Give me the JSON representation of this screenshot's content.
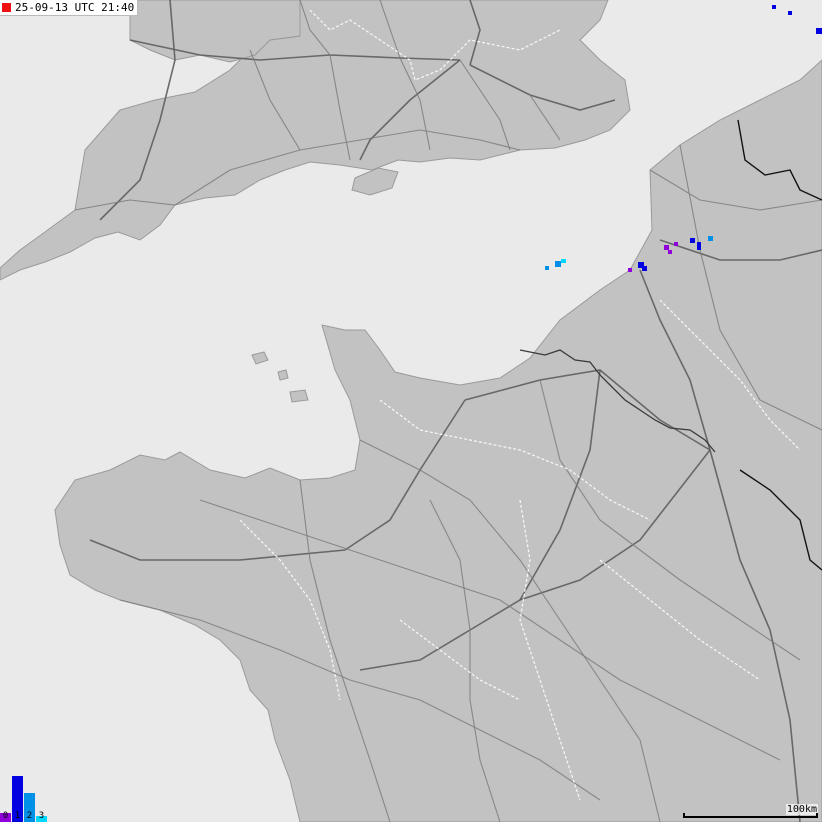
{
  "header": {
    "timestamp": "25-09-13 UTC 21:40",
    "indicator_color": "#ee1111"
  },
  "legend": {
    "items": [
      {
        "label": "0",
        "color": "#9000d8",
        "level": 0.2
      },
      {
        "label": "1",
        "color": "#0000e0",
        "level": 1.0
      },
      {
        "label": "2",
        "color": "#0090e8",
        "level": 0.62
      },
      {
        "label": "3",
        "color": "#00d8ff",
        "level": 0.12
      }
    ]
  },
  "scale": {
    "label": "100km"
  },
  "colors": {
    "sea": "#eaeaea",
    "land": "#c2c2c2",
    "roads": "#7d7d7d",
    "borders": "#111111",
    "admin_lines": "#ffffff"
  }
}
